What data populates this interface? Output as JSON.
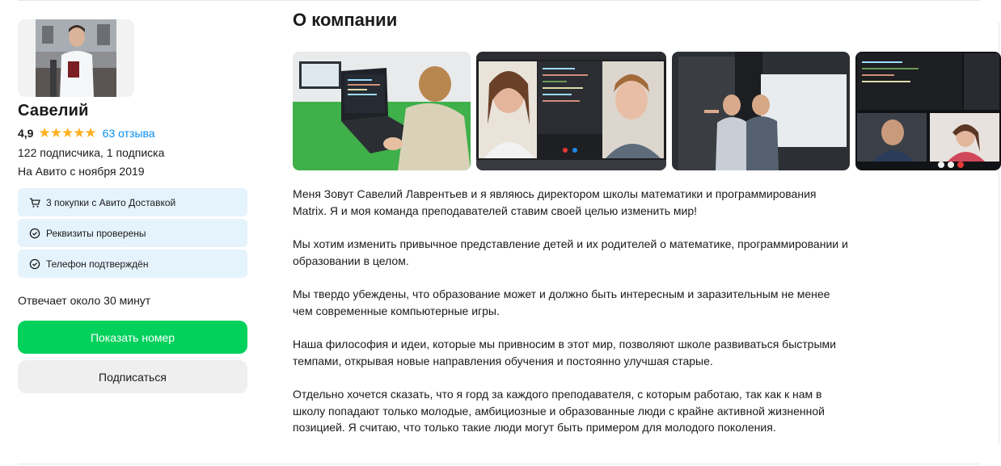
{
  "seller": {
    "name": "Савелий",
    "rating": "4,9",
    "stars": "★★★★★",
    "reviews_link": "63 отзыва",
    "subscriptions": "122 подписчика, 1 подписка",
    "since": "На Авито с ноября 2019",
    "badges": [
      {
        "icon": "cart-icon",
        "label": "3 покупки с Авито Доставкой"
      },
      {
        "icon": "check-circle-icon",
        "label": "Реквизиты проверены"
      },
      {
        "icon": "check-circle-icon",
        "label": "Телефон подтверждён"
      }
    ],
    "reply_time": "Отвечает около 30 минут",
    "show_phone_button": "Показать номер",
    "subscribe_button": "Подписаться"
  },
  "company": {
    "title": "О компании",
    "paragraphs": [
      "Меня Зовут Савелий Лаврентьев и я являюсь директором школы математики и программирования Matrix. Я и моя команда преподавателей ставим своей целью изменить мир!",
      "Мы хотим изменить привычное представление детей и их родителей о математике, программировании и образовании в целом.",
      "Мы твердо убеждены, что образование может и должно быть интересным и заразительным не менее чем современные компьютерные игры.",
      "Наша философия и идеи, которые мы привносим в этот мир, позволяют школе развиваться быстрыми темпами, открывая новые направления обучения и постоянно улучшая старые.",
      "Отдельно хочется сказать, что я горд за каждого преподавателя, с которым работаю, так как к нам в школу попадают только молодые, амбициозные и образованные люди с крайне активной жизненной позицией. Я считаю, что только такие люди могут быть примером для молодого поколения."
    ]
  },
  "colors": {
    "accent_green": "#02d15c",
    "link_blue": "#0a8ff0",
    "star": "#ffb021",
    "badge_bg": "#e5f3fd"
  }
}
